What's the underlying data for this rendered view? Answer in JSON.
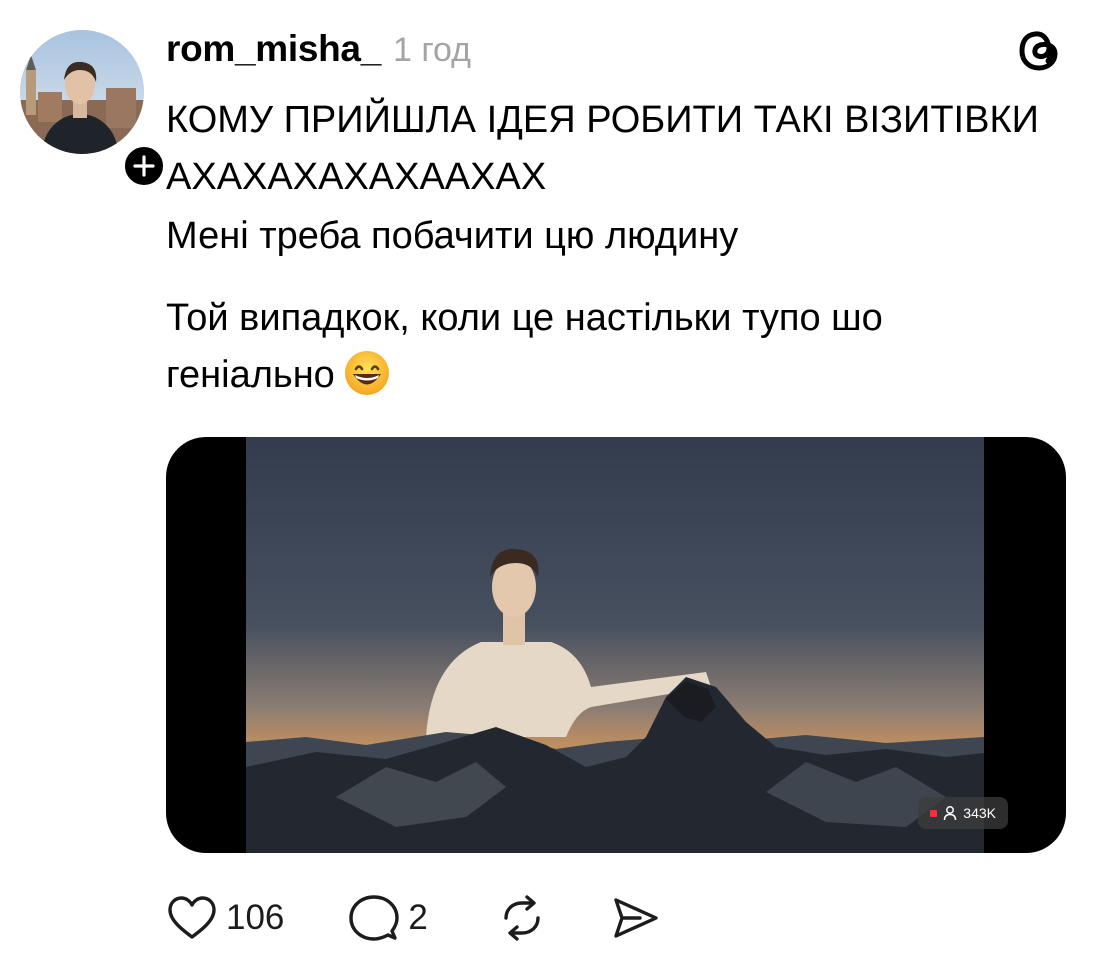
{
  "post": {
    "username": "rom_misha_",
    "timestamp": "1 год",
    "text_lines": [
      "КОМУ ПРИЙШЛА ІДЕЯ РОБИТИ ТАКІ ВІЗИТІВКИ АХАХАХАХАХААХАХ",
      "Мені треба побачити цю людину",
      "Той випадкок, коли це настільки тупо шо геніально"
    ],
    "emoji": "grinning-face-with-smiling-eyes",
    "media": {
      "view_count": "343K"
    }
  },
  "actions": {
    "likes": "106",
    "comments": "2"
  },
  "icons": {
    "logo": "threads-logo-icon",
    "follow": "plus-icon",
    "like": "heart-icon",
    "comment": "comment-icon",
    "repost": "repost-icon",
    "share": "send-icon",
    "viewer": "person-icon"
  },
  "colors": {
    "timestamp": "#a4a4a4",
    "live_dot": "#ff2d3f"
  }
}
